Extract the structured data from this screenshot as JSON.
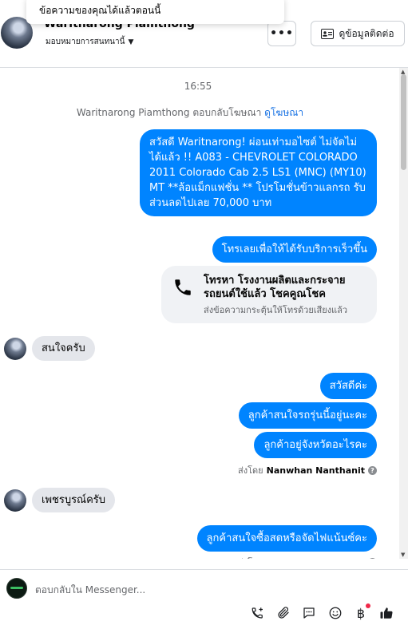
{
  "toast": {
    "text": "ข้อความของคุณได้แล้วตอนนี้"
  },
  "header": {
    "name": "Waritnarong Piamthong",
    "assign_label": "มอบหมายการสนทนานี้",
    "more_label": "•••",
    "contact_label": "ดูข้อมูลติดต่อ"
  },
  "chat": {
    "timestamp": "16:55",
    "system": {
      "prefix": "Waritnarong Piamthong ตอบกลับโฆษณา",
      "link": "ดูโฆษณา"
    },
    "messages": [
      {
        "from": "page",
        "text": "สวัสดี Waritnarong! ผ่อนเท่ามอไซต์ ไม่จัดไม่ได้แล้ว !! A083 - CHEVROLET COLORADO 2011 Colorado Cab 2.5 LS1 (MNC) (MY10) MT **ล้อแม็กแฟชั่น ** โปรโมชั่นข้าวแลกรถ รับส่วนลดไปเลย 70,000 บาท"
      },
      {
        "from": "page",
        "text": "โทรเลยเพื่อให้ได้รับบริการเร็วขึ้น"
      },
      {
        "from": "user",
        "text": "สนใจครับ"
      },
      {
        "from": "page",
        "text": "สวัสดีค่ะ"
      },
      {
        "from": "page",
        "text": "ลูกค้าสนใจรถรุ่นนี้อยู่นะคะ"
      },
      {
        "from": "page",
        "text": "ลูกค้าอยู่จังหวัดอะไรคะ"
      },
      {
        "from": "user",
        "text": "เพชรบูรณ์ครับ"
      },
      {
        "from": "page",
        "text": "ลูกค้าสนใจซื้อสดหรือจัดไฟแน้นซ์คะ"
      }
    ],
    "call_card": {
      "title": "โทรหา โรงงานผลิตและกระจายรถยนต์ใช้แล้ว โชคคูณโชค",
      "subtitle": "ส่งข้อความกระตุ้นให้โทรด้วยเสียงแล้ว"
    },
    "sent_by_prefix": "ส่งโดย",
    "sent_by_name": "Nanwhan Nanthanit"
  },
  "composer": {
    "placeholder": "ตอบกลับใน Messenger...",
    "tools": [
      "phone-add-icon",
      "attachment-icon",
      "saved-replies-icon",
      "emoji-icon",
      "payment-icon",
      "like-icon"
    ]
  }
}
